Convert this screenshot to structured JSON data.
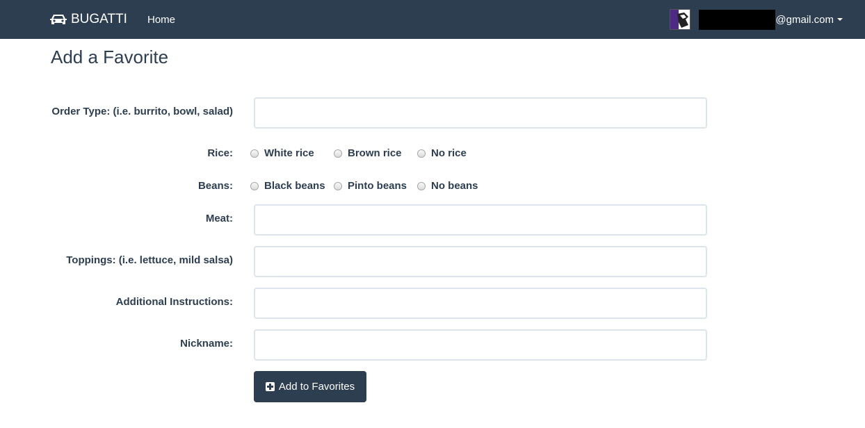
{
  "navbar": {
    "brand": "BUGATTI",
    "brand_icon": "car-icon",
    "home": "Home",
    "user_email_suffix": "@gmail.com",
    "user_email_prefix_redacted": true
  },
  "page": {
    "title": "Add a Favorite"
  },
  "form": {
    "order_type_label": "Order Type: (i.e. burrito, bowl, salad)",
    "order_type_value": "",
    "rice_label": "Rice:",
    "rice_options": [
      "White rice",
      "Brown rice",
      "No rice"
    ],
    "beans_label": "Beans:",
    "beans_options": [
      "Black beans",
      "Pinto beans",
      "No beans"
    ],
    "meat_label": "Meat:",
    "meat_value": "",
    "toppings_label": "Toppings: (i.e. lettuce, mild salsa)",
    "toppings_value": "",
    "instructions_label": "Additional Instructions:",
    "instructions_value": "",
    "nickname_label": "Nickname:",
    "nickname_value": "",
    "submit_label": "Add to Favorites",
    "submit_icon": "plus-square-icon"
  },
  "colors": {
    "primary": "#2c3e50",
    "input_border": "#dce4ec"
  }
}
